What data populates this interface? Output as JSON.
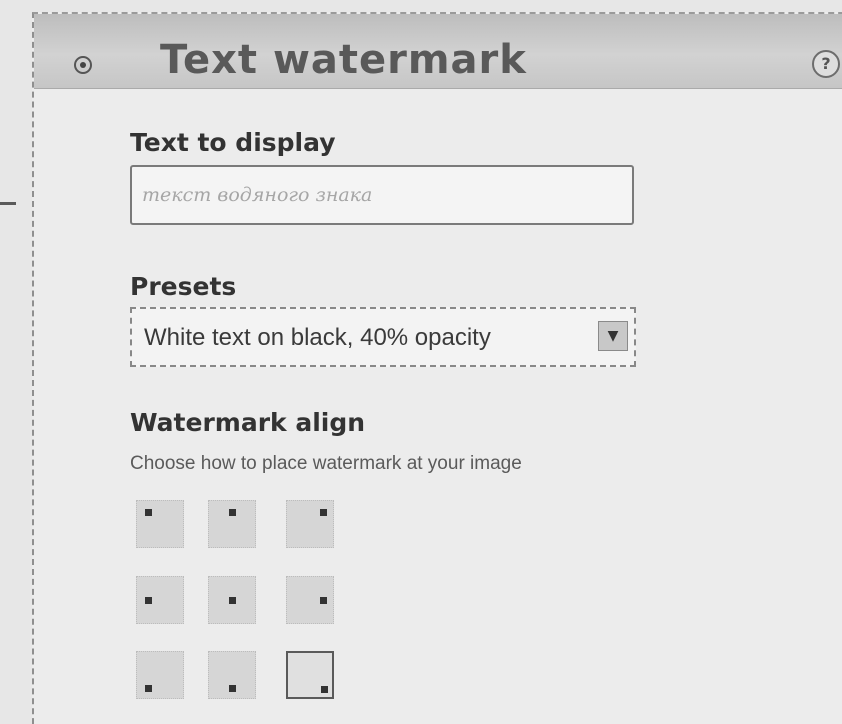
{
  "panel": {
    "title": "Text watermark",
    "help_icon_glyph": "?",
    "collapse_icon": "radio-collapse-icon"
  },
  "text_to_display": {
    "label": "Text to display",
    "value": "",
    "placeholder": "текст водяного знака"
  },
  "presets": {
    "label": "Presets",
    "selected": "White text on black, 40% opacity",
    "arrow_glyph": "▼"
  },
  "watermark_align": {
    "label": "Watermark align",
    "hint": "Choose how to place watermark at your image",
    "positions": [
      {
        "name": "top-left",
        "selected": false
      },
      {
        "name": "top-center",
        "selected": false
      },
      {
        "name": "top-right",
        "selected": false
      },
      {
        "name": "middle-left",
        "selected": false
      },
      {
        "name": "center",
        "selected": false
      },
      {
        "name": "middle-right",
        "selected": false
      },
      {
        "name": "bottom-left",
        "selected": false
      },
      {
        "name": "bottom-center",
        "selected": false
      },
      {
        "name": "bottom-right",
        "selected": true
      }
    ]
  },
  "colors": {
    "header_background": "#c6c6c6",
    "panel_background": "#ececec",
    "title_text": "#595959",
    "label_text": "#333333"
  }
}
